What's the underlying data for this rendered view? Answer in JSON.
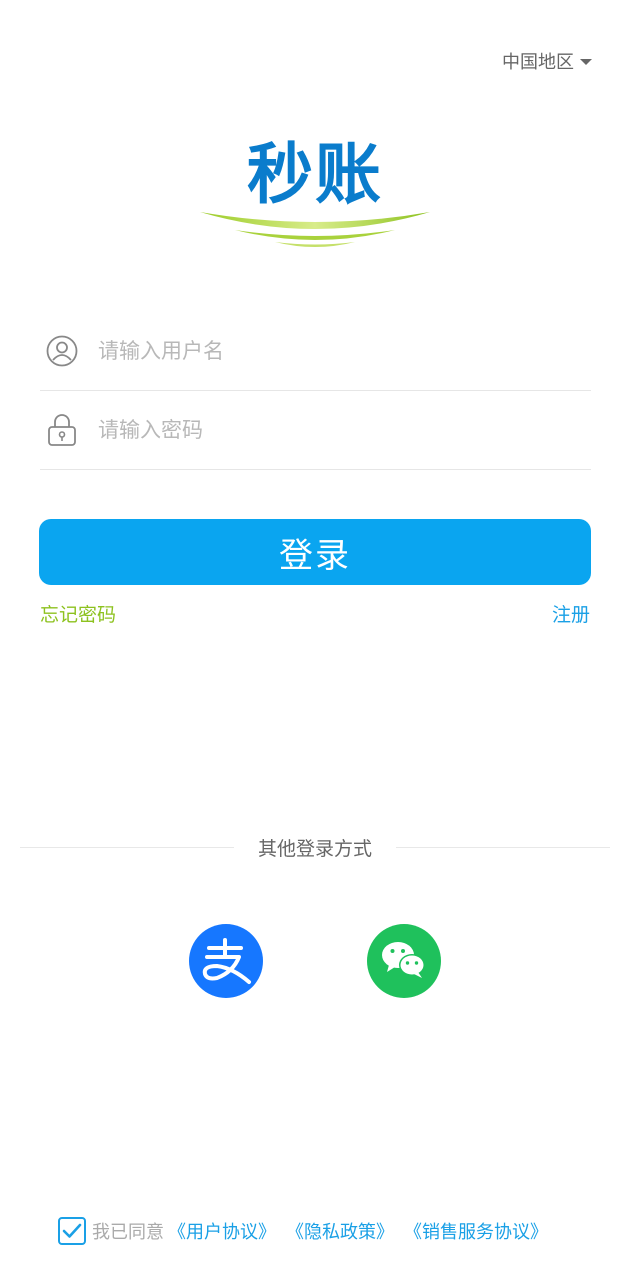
{
  "header": {
    "region_label": "中国地区"
  },
  "logo": {
    "text": "秒账",
    "brand_blue": "#0a7ccc",
    "swoosh_green": "#8dc21f"
  },
  "form": {
    "username_placeholder": "请输入用户名",
    "password_placeholder": "请输入密码",
    "login_label": "登录",
    "forgot_label": "忘记密码",
    "register_label": "注册"
  },
  "other_login": {
    "title": "其他登录方式",
    "providers": [
      {
        "name": "alipay",
        "icon": "alipay-icon",
        "color": "#1677ff"
      },
      {
        "name": "wechat",
        "icon": "wechat-icon",
        "color": "#1fc15c"
      }
    ]
  },
  "agreement": {
    "checked": true,
    "prefix": "我已同意",
    "links": [
      "《用户协议》",
      "《隐私政策》",
      "《销售服务协议》"
    ]
  },
  "colors": {
    "primary": "#0aa5f0",
    "link": "#1aa0e6",
    "forgot": "#8dc21f"
  }
}
